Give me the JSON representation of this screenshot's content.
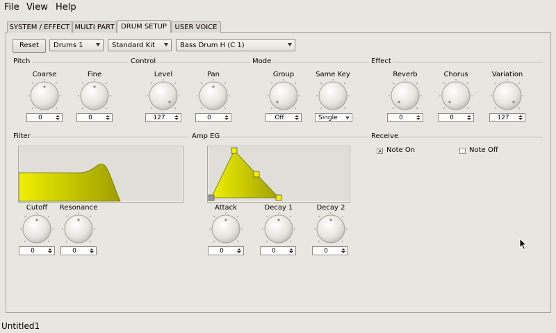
{
  "menu": {
    "file": "File",
    "view": "View",
    "help": "Help"
  },
  "tabs": [
    "SYSTEM / EFFECT",
    "MULTI PART",
    "DRUM SETUP",
    "USER VOICE"
  ],
  "toolbar": {
    "reset": "Reset",
    "drums": "Drums 1",
    "kit": "Standard Kit",
    "instrument": "Bass Drum H (C  1)"
  },
  "sections": {
    "pitch": "Pitch",
    "control": "Control",
    "mode": "Mode",
    "effect": "Effect",
    "filter": "Filter",
    "amp_eg": "Amp EG",
    "receive": "Receive"
  },
  "knobs": {
    "coarse": {
      "label": "Coarse",
      "value": "0"
    },
    "fine": {
      "label": "Fine",
      "value": "0"
    },
    "level": {
      "label": "Level",
      "value": "127"
    },
    "pan": {
      "label": "Pan",
      "value": "0"
    },
    "reverb": {
      "label": "Reverb",
      "value": "0"
    },
    "chorus": {
      "label": "Chorus",
      "value": "0"
    },
    "variation": {
      "label": "Variation",
      "value": "127"
    },
    "cutoff": {
      "label": "Cutoff",
      "value": "0"
    },
    "resonance": {
      "label": "Resonance",
      "value": "0"
    },
    "attack": {
      "label": "Attack",
      "value": "0"
    },
    "decay1": {
      "label": "Decay 1",
      "value": "0"
    },
    "decay2": {
      "label": "Decay 2",
      "value": "0"
    }
  },
  "mode": {
    "group": {
      "label": "Group",
      "value": "Off"
    },
    "same_key": {
      "label": "Same Key",
      "value": "Single"
    }
  },
  "receive": {
    "note_on": {
      "label": "Note On",
      "mark": "×",
      "checked": true
    },
    "note_off": {
      "label": "Note Off",
      "checked": false
    }
  },
  "colors": {
    "graph_fill": "#e3e300",
    "graph_fill_dark": "#a8a800",
    "handle": "#f0f000"
  },
  "status": "Untitled1"
}
